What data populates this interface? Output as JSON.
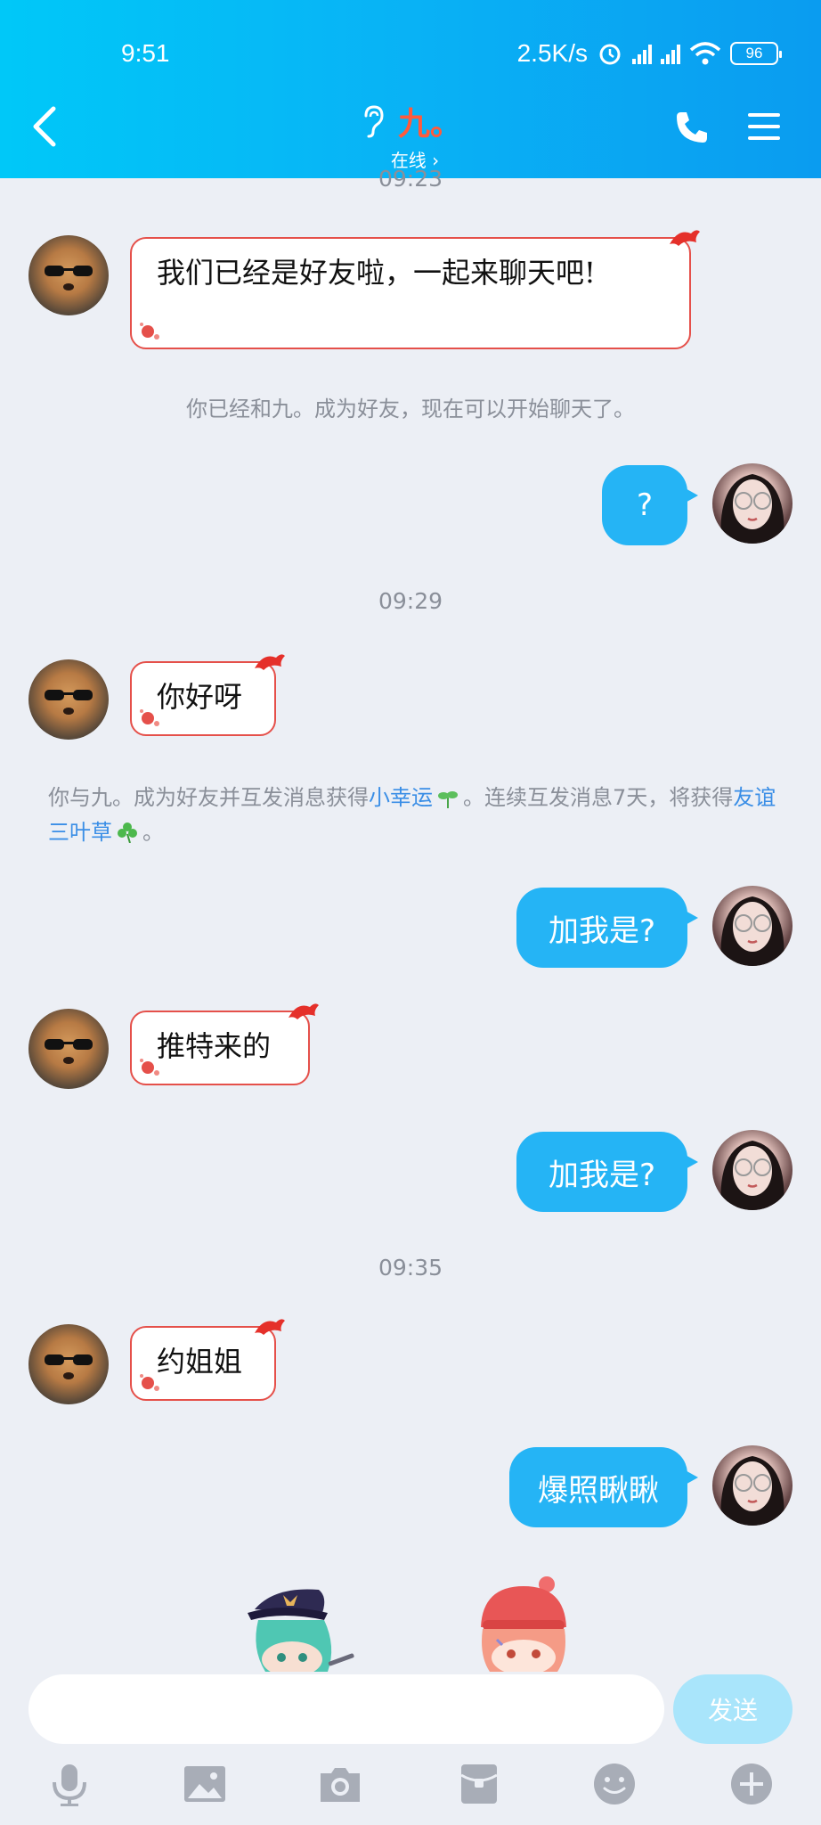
{
  "status_bar": {
    "time": "9:51",
    "net_speed": "2.5K/s",
    "battery": "96"
  },
  "header": {
    "name": "九。",
    "presence": "在线 ›"
  },
  "messages": {
    "ts_top": "09:23",
    "m1": "我们已经是好友啦，一起来聊天吧!",
    "sys1": "你已经和九。成为好友，现在可以开始聊天了。",
    "r1": "?",
    "ts2": "09:29",
    "m2": "你好呀",
    "sys2_a": "你与九。成为好友并互发消息获得",
    "sys2_link1": "小幸运",
    "sys2_b": "。连续互发消息7天，将获得",
    "sys2_link2": "友谊三叶草",
    "sys2_c": "。",
    "r2": "加我是?",
    "m3": "推特来的",
    "r3": "加我是?",
    "ts3": "09:35",
    "m4": "约姐姐",
    "r4": "爆照瞅瞅"
  },
  "input": {
    "placeholder": "",
    "send_label": "发送"
  },
  "colors": {
    "header_start": "#00c8f8",
    "header_end": "#0a9cf0",
    "bubble_blue": "#25b4f5",
    "name_red": "#ff5a3c",
    "link_blue": "#3a8ee6"
  },
  "icons": [
    "back-icon",
    "ear-icon",
    "phone-icon",
    "menu-icon",
    "mic-icon",
    "image-icon",
    "camera-icon",
    "red-packet-icon",
    "emoji-icon",
    "plus-icon"
  ]
}
